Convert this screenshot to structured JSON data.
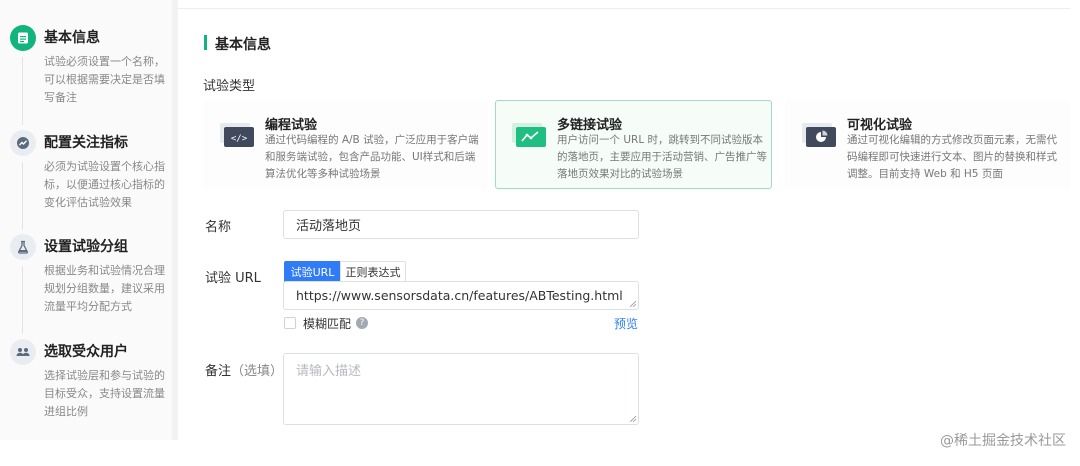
{
  "steps": [
    {
      "title": "基本信息",
      "desc": "试验必须设置一个名称，可以根据需要决定是否填写备注",
      "icon": "document-icon",
      "active": true
    },
    {
      "title": "配置关注指标",
      "desc": "必须为试验设置个核心指标，以便通过核心指标的变化评估试验效果",
      "icon": "trend-icon",
      "active": false
    },
    {
      "title": "设置试验分组",
      "desc": "根据业务和试验情况合理规划分组数量，建议采用流量平均分配方式",
      "icon": "flask-icon",
      "active": false
    },
    {
      "title": "选取受众用户",
      "desc": "选择试验层和参与试验的目标受众，支持设置流量进组比例",
      "icon": "users-icon",
      "active": false
    }
  ],
  "section": {
    "title": "基本信息"
  },
  "type_label": "试验类型",
  "types": [
    {
      "title": "编程试验",
      "desc": "通过代码编程的 A/B 试验，广泛应用于客户端和服务端试验，包含产品功能、UI样式和后端算法优化等多种试验场景",
      "icon": "code-icon",
      "selected": false
    },
    {
      "title": "多链接试验",
      "desc": "用户访问一个 URL 时，跳转到不同试验版本的落地页，主要应用于活动营销、广告推广等落地页效果对比的试验场景",
      "icon": "link-chart-icon",
      "selected": true
    },
    {
      "title": "可视化试验",
      "desc": "通过可视化编辑的方式修改页面元素，无需代码编程即可快速进行文本、图片的替换和样式调整。目前支持 Web 和 H5 页面",
      "icon": "visual-chart-icon",
      "selected": false
    }
  ],
  "form": {
    "name_label": "名称",
    "name_value": "活动落地页",
    "url_label": "试验 URL",
    "url_tabs": [
      "试验URL",
      "正则表达式"
    ],
    "url_value": "https://www.sensorsdata.cn/features/ABTesting.html",
    "fuzzy_label": "模糊匹配",
    "preview_label": "预览",
    "note_label": "备注",
    "note_optional": "（选填）",
    "note_placeholder": "请输入描述"
  },
  "watermark": "@稀土掘金技术社区",
  "colors": {
    "accent": "#10b47c",
    "link": "#2f7cf6"
  }
}
